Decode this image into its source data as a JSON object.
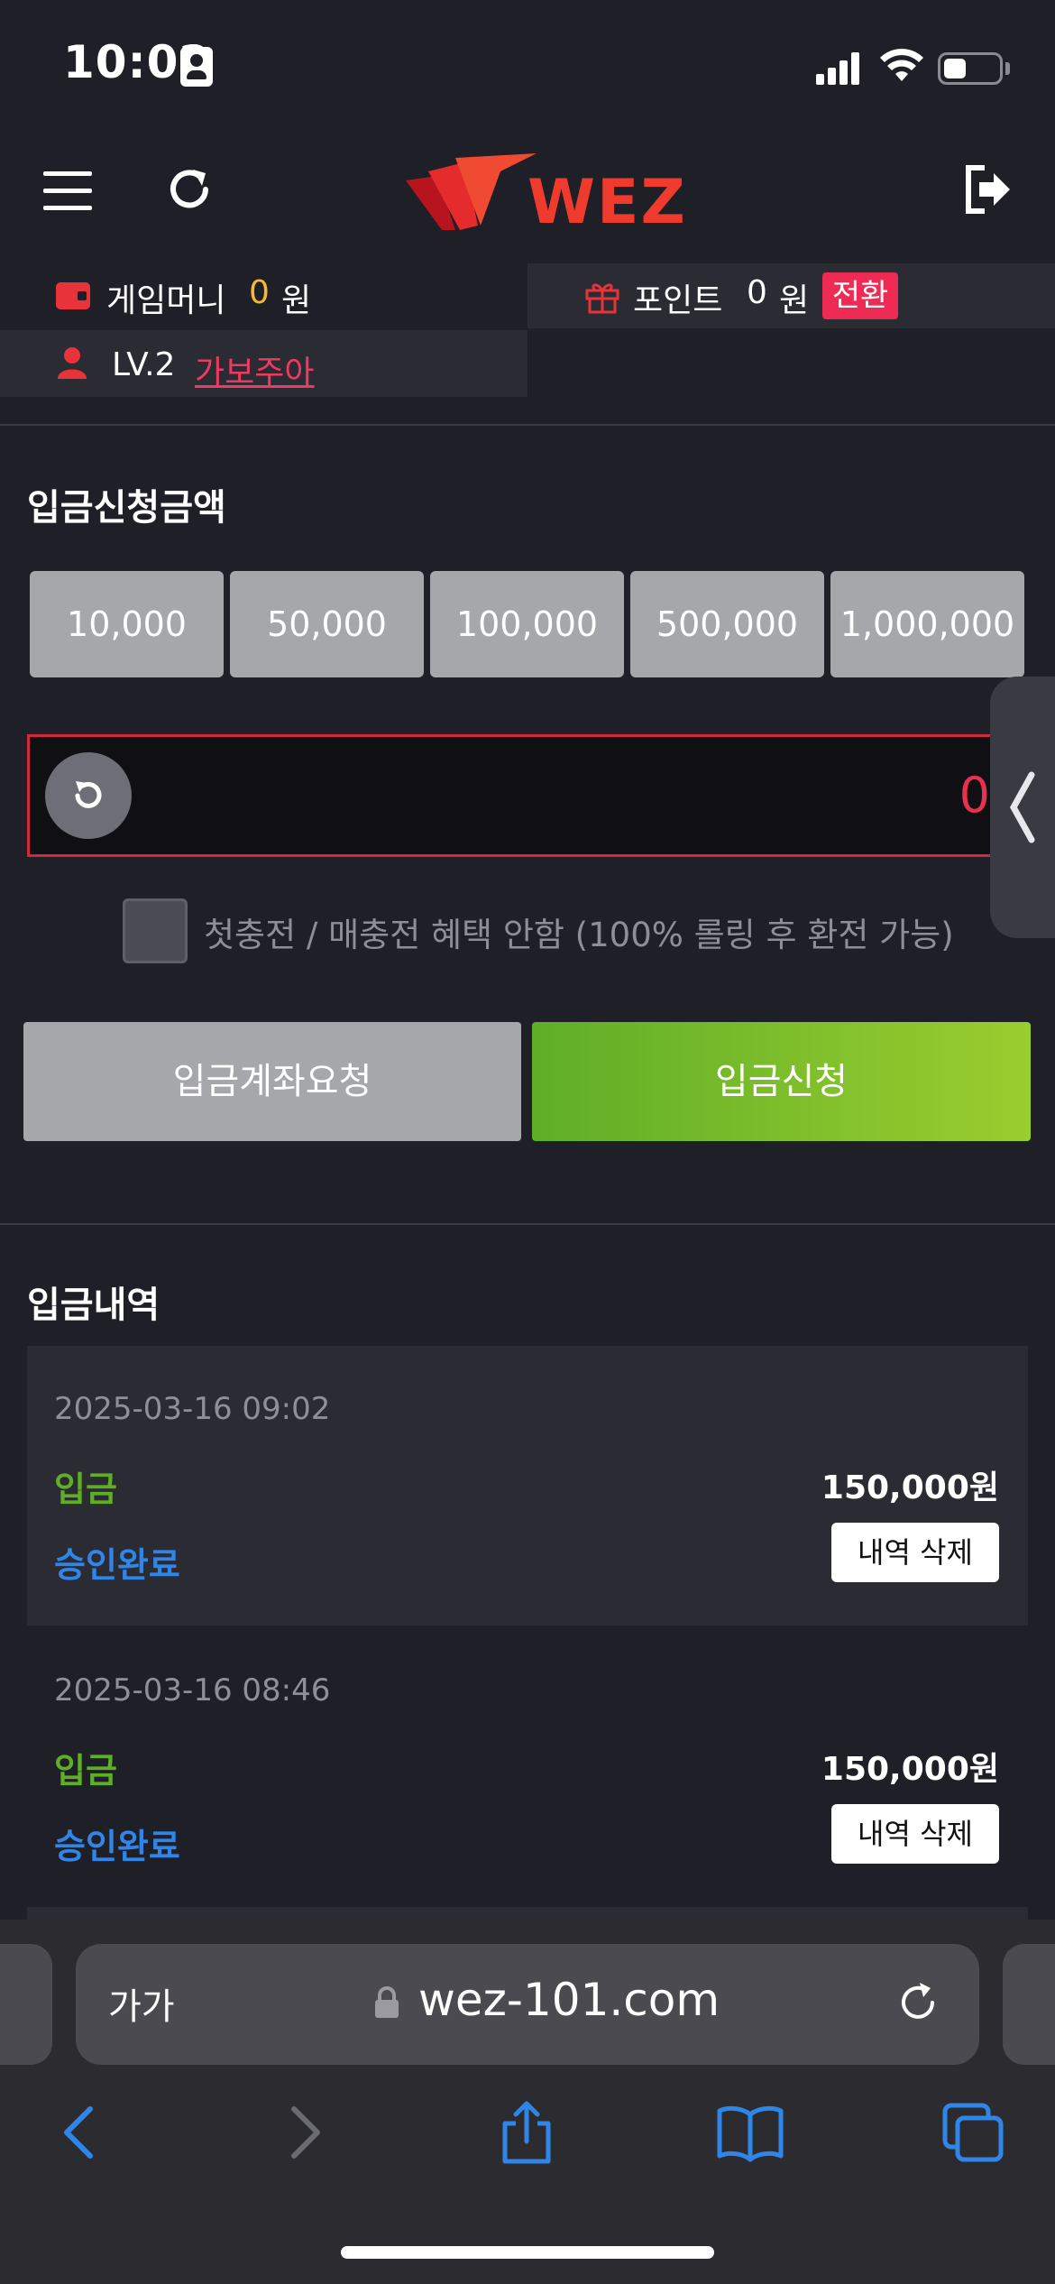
{
  "status_bar": {
    "time": "10:02"
  },
  "header": {
    "logo_text": "WEZ",
    "menu_icon": "hamburger-menu-icon",
    "refresh_icon": "refresh-icon",
    "logout_icon": "logout-icon"
  },
  "info_bar": {
    "game_money_label": "게임머니",
    "game_money_value": "0",
    "won_unit": "원",
    "point_label": "포인트",
    "point_value": "0",
    "convert_button": "전환",
    "level": "LV.2",
    "username": "가보주아"
  },
  "deposit": {
    "title": "입금신청금액",
    "amount_buttons": [
      "10,000",
      "50,000",
      "100,000",
      "500,000",
      "1,000,000"
    ],
    "amount_value": "0",
    "bonus_checkbox_label": "첫충전 / 매충전 혜택 안함 (100% 롤링 후 환전 가능)",
    "account_request_button": "입금계좌요청",
    "apply_button": "입금신청"
  },
  "history": {
    "title": "입금내역",
    "items": [
      {
        "date": "2025-03-16 09:02",
        "type": "입금",
        "amount": "150,000원",
        "status": "승인완료",
        "delete_button": "내역 삭제"
      },
      {
        "date": "2025-03-16 08:46",
        "type": "입금",
        "amount": "150,000원",
        "status": "승인완료",
        "delete_button": "내역 삭제"
      }
    ]
  },
  "browser": {
    "aa_label": "가가",
    "url": "wez-101.com"
  },
  "colors": {
    "background": "#1f1f27",
    "accent_red": "#e8304f",
    "green": "#5fae28",
    "blue": "#2f86e8",
    "gold": "#f5b82e"
  }
}
